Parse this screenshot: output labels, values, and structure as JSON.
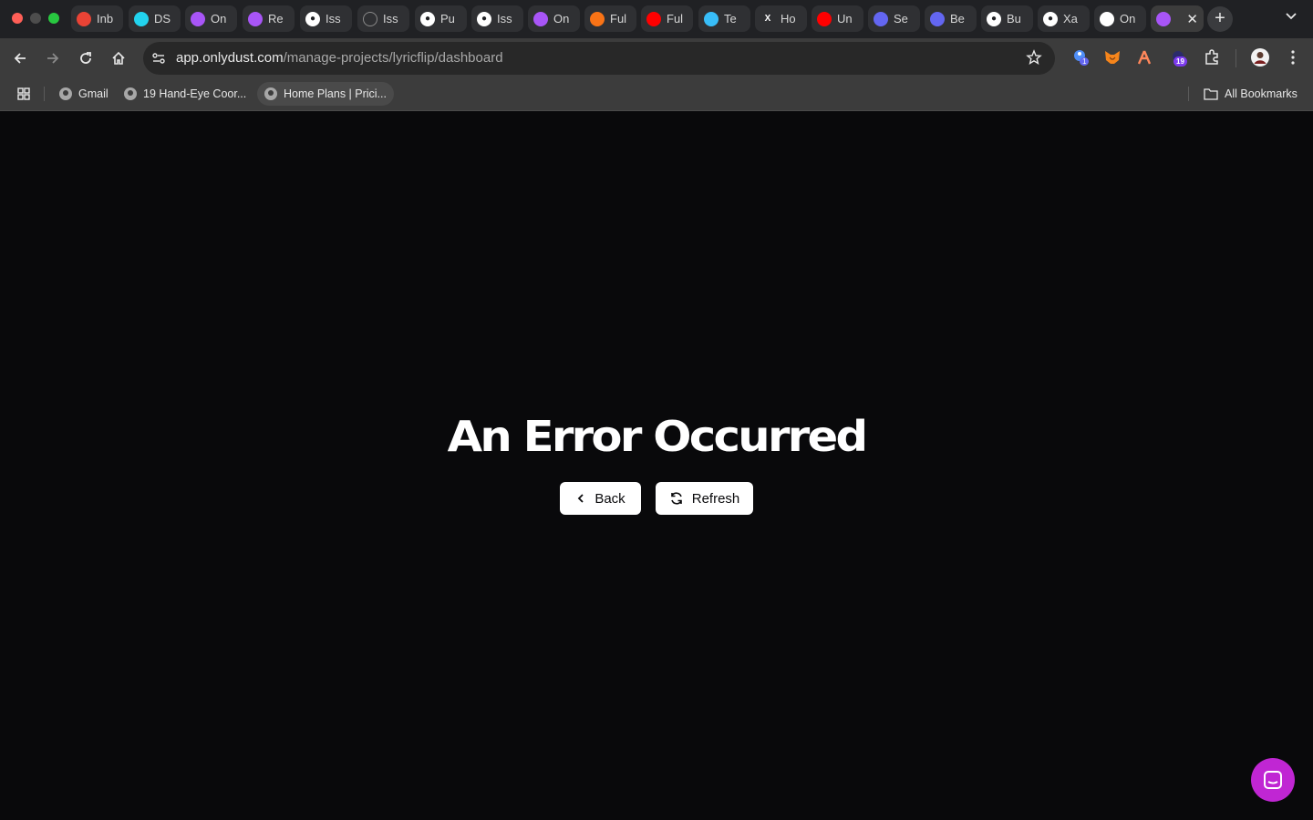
{
  "browser": {
    "tabs": [
      {
        "title": "Inb",
        "icon": "gmail-icon",
        "color": "#ea4335"
      },
      {
        "title": "DS",
        "icon": "ds-icon",
        "color": "#22d3ee"
      },
      {
        "title": "On",
        "icon": "onlydust-icon",
        "color": "#a855f7"
      },
      {
        "title": "Re",
        "icon": "onlydust-icon",
        "color": "#a855f7"
      },
      {
        "title": "Iss",
        "icon": "github-icon",
        "color": "#ffffff"
      },
      {
        "title": "Iss",
        "icon": "loading-icon",
        "color": "#8a8a8a"
      },
      {
        "title": "Pu",
        "icon": "github-icon",
        "color": "#ffffff"
      },
      {
        "title": "Iss",
        "icon": "github-icon",
        "color": "#ffffff"
      },
      {
        "title": "On",
        "icon": "onlydust-icon",
        "color": "#a855f7"
      },
      {
        "title": "Ful",
        "icon": "claude-icon",
        "color": "#f97316"
      },
      {
        "title": "Ful",
        "icon": "youtube-icon",
        "color": "#ff0000"
      },
      {
        "title": "Te",
        "icon": "tailwind-icon",
        "color": "#38bdf8"
      },
      {
        "title": "Ho",
        "icon": "x-icon",
        "color": "#ffffff"
      },
      {
        "title": "Un",
        "icon": "youtube-icon",
        "color": "#ff0000"
      },
      {
        "title": "Se",
        "icon": "avatar-icon",
        "color": "#6366f1"
      },
      {
        "title": "Be",
        "icon": "avatar-icon",
        "color": "#6366f1"
      },
      {
        "title": "Bu",
        "icon": "github-icon",
        "color": "#ffffff"
      },
      {
        "title": "Xa",
        "icon": "github-icon",
        "color": "#ffffff"
      },
      {
        "title": "On",
        "icon": "onlydust-icon",
        "color": "#ffffff"
      }
    ],
    "active_tab": {
      "icon": "onlydust-icon"
    },
    "url_domain": "app.onlydust.com",
    "url_path": "/manage-projects/lyricflip/dashboard",
    "extension_badge_count": "19",
    "extension_badge_small": "1",
    "bookmarks": [
      {
        "label": "Gmail"
      },
      {
        "label": "19 Hand-Eye Coor..."
      },
      {
        "label": "Home Plans | Prici..."
      }
    ],
    "all_bookmarks_label": "All Bookmarks"
  },
  "page": {
    "title": "An Error Occurred",
    "back_label": "Back",
    "refresh_label": "Refresh",
    "accent_color": "#c026d3"
  }
}
